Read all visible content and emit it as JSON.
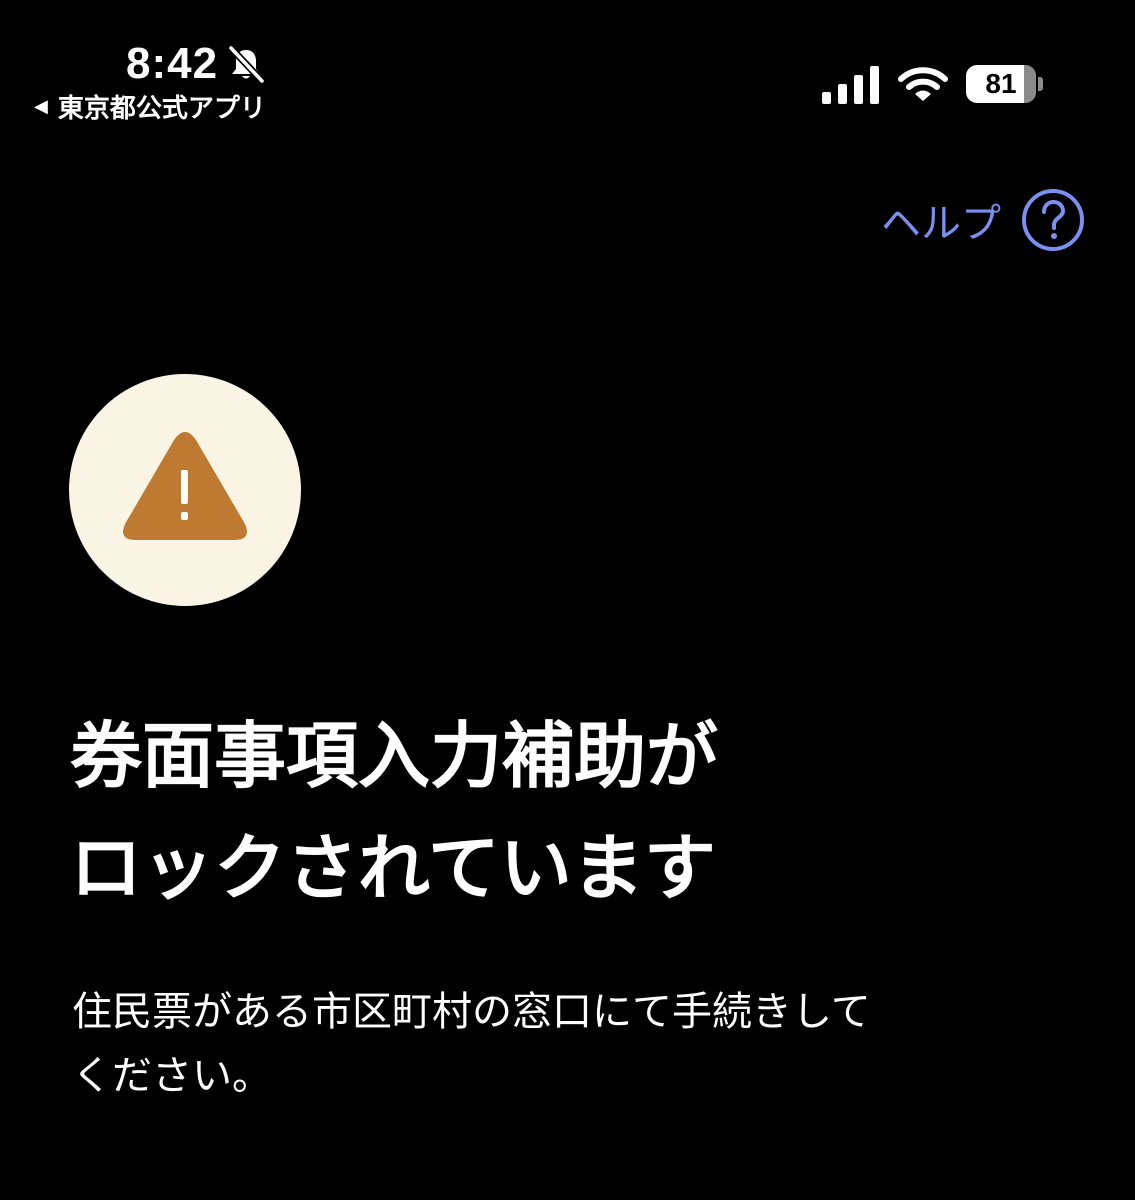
{
  "status_bar": {
    "time": "8:42",
    "back_app": "東京都公式アプリ",
    "battery_level": "81"
  },
  "help": {
    "label": "ヘルプ",
    "icon": "question-circle-icon"
  },
  "alert": {
    "icon": "warning-triangle-icon",
    "title_lines": [
      "券面事項入力補助が",
      "ロックされています"
    ],
    "message_lines": [
      "住民票がある市区町村の窓口にて手続きして",
      "ください。"
    ]
  },
  "colors": {
    "background": "#000000",
    "link": "#7b8ff0",
    "alert_circle": "#faf4e4",
    "warning": "#bf7a32"
  }
}
